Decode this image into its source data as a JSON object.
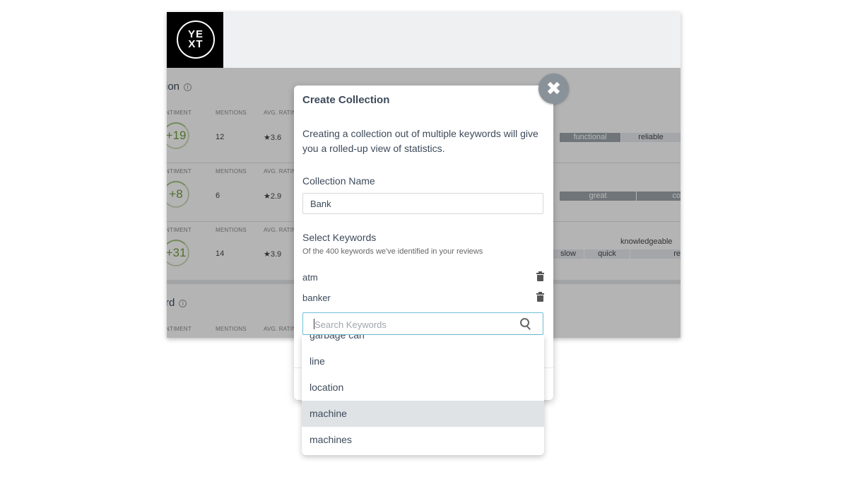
{
  "brand": {
    "logo_top": "YE",
    "logo_bottom": "XT"
  },
  "background": {
    "sections": [
      {
        "title": "ion"
      },
      {
        "title": "rd"
      }
    ],
    "column_headers": {
      "sentiment": "NTIMENT",
      "mentions": "MENTIONS",
      "rating": "AVG. RATIN"
    },
    "rows": [
      {
        "score": "+19",
        "mentions": "12",
        "rating": "★3.6",
        "tags": [
          "functional",
          "reliable"
        ]
      },
      {
        "score": "+8",
        "mentions": "6",
        "rating": "★2.9",
        "tags": [
          "great",
          "co"
        ]
      },
      {
        "score": "+31",
        "mentions": "14",
        "rating": "★3.9",
        "tags": [
          "slow",
          "quick",
          "re"
        ],
        "floating_tag": "knowledgeable"
      }
    ]
  },
  "modal": {
    "title": "Create Collection",
    "description": "Creating a collection out of multiple keywords will give you a rolled-up view of statistics.",
    "name_label": "Collection Name",
    "name_value": "Bank",
    "keywords_label": "Select Keywords",
    "keywords_sub": "Of the 400 keywords we've identified in your reviews",
    "selected_keywords": [
      "atm",
      "banker"
    ],
    "search_placeholder": "Search Keywords",
    "close_glyph": "✖"
  },
  "dropdown": {
    "options": [
      "garbage can",
      "line",
      "location",
      "machine",
      "machines"
    ],
    "active": "machine"
  },
  "colors": {
    "accent": "#70c0d8",
    "text": "#3d4a5a",
    "positive": "#6f9b3e"
  }
}
